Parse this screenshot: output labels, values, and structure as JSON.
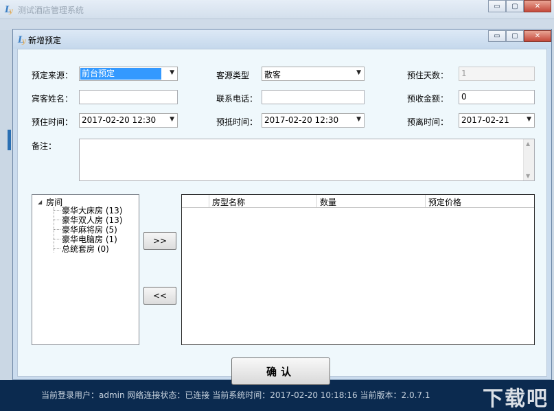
{
  "main_window": {
    "title": "测试酒店管理系统",
    "minimize_label": "▭",
    "maximize_label": "▢",
    "close_label": "✕",
    "status_text": "当前登录用户：admin    网络连接状态：已连接    当前系统时间：2017-02-20 10:18:16    当前版本：2.0.7.1",
    "watermark": "下载吧"
  },
  "dialog": {
    "title": "新增预定",
    "minimize_label": "▭",
    "maximize_label": "▢",
    "close_label": "✕"
  },
  "form": {
    "booking_source_label": "预定来源：",
    "booking_source_value": "前台预定",
    "guest_type_label": "客源类型",
    "guest_type_value": "散客",
    "stay_days_label": "预住天数：",
    "stay_days_value": "1",
    "guest_name_label": "宾客姓名：",
    "guest_name_value": "",
    "phone_label": "联系电话：",
    "phone_value": "",
    "prepay_label": "预收金额：",
    "prepay_value": "0",
    "checkin_time_label": "预住时间：",
    "checkin_time_value": "2017-02-20  12:30",
    "arrival_time_label": "预抵时间：",
    "arrival_time_value": "2017-02-20  12:30",
    "departure_time_label": "预离时间：",
    "departure_time_value": "2017-02-21",
    "notes_label": "备注：",
    "notes_value": ""
  },
  "tree": {
    "root": "房间",
    "items": [
      "豪华大床房 (13)",
      "豪华双人房 (13)",
      "豪华麻将房 (5)",
      "豪华电脑房 (1)",
      "总统套房 (0)"
    ]
  },
  "buttons": {
    "add": ">>",
    "remove": "<<",
    "confirm": "确认"
  },
  "grid": {
    "columns": [
      "房型名称",
      "数量",
      "预定价格"
    ]
  }
}
